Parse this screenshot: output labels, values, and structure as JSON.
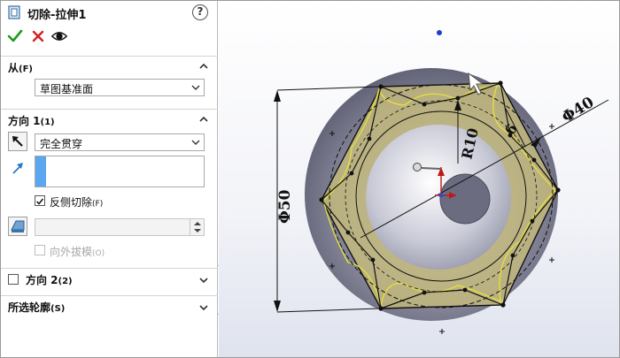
{
  "feature": {
    "title": "切除-拉伸1"
  },
  "help": {
    "label": "?"
  },
  "from_section": {
    "title": "从",
    "hotkey": "(F)",
    "start_condition": "草图基准面"
  },
  "direction1": {
    "title": "方向 1",
    "hotkey": "(1)",
    "end_condition": "完全贯穿",
    "flip_side_label": "反侧切除",
    "flip_side_hotkey": "(F)",
    "flip_side_checked": true,
    "draft_outward_label": "向外拔模",
    "draft_outward_hotkey": "(O)"
  },
  "direction2": {
    "title": "方向 2",
    "hotkey": "(2)"
  },
  "selected_contours": {
    "title": "所选轮廓",
    "hotkey": "(S)"
  },
  "dimensions": {
    "height": "Φ50",
    "outer": "Φ40",
    "radius": "R10",
    "width": "6"
  },
  "colors": {
    "accept": "#1e9b1e",
    "cancel": "#d42020",
    "selection": "#5aa7ef",
    "preview_fill": "#b9b07a",
    "preview_edge": "#e8e03a",
    "sphere": "#7e7e8f"
  }
}
